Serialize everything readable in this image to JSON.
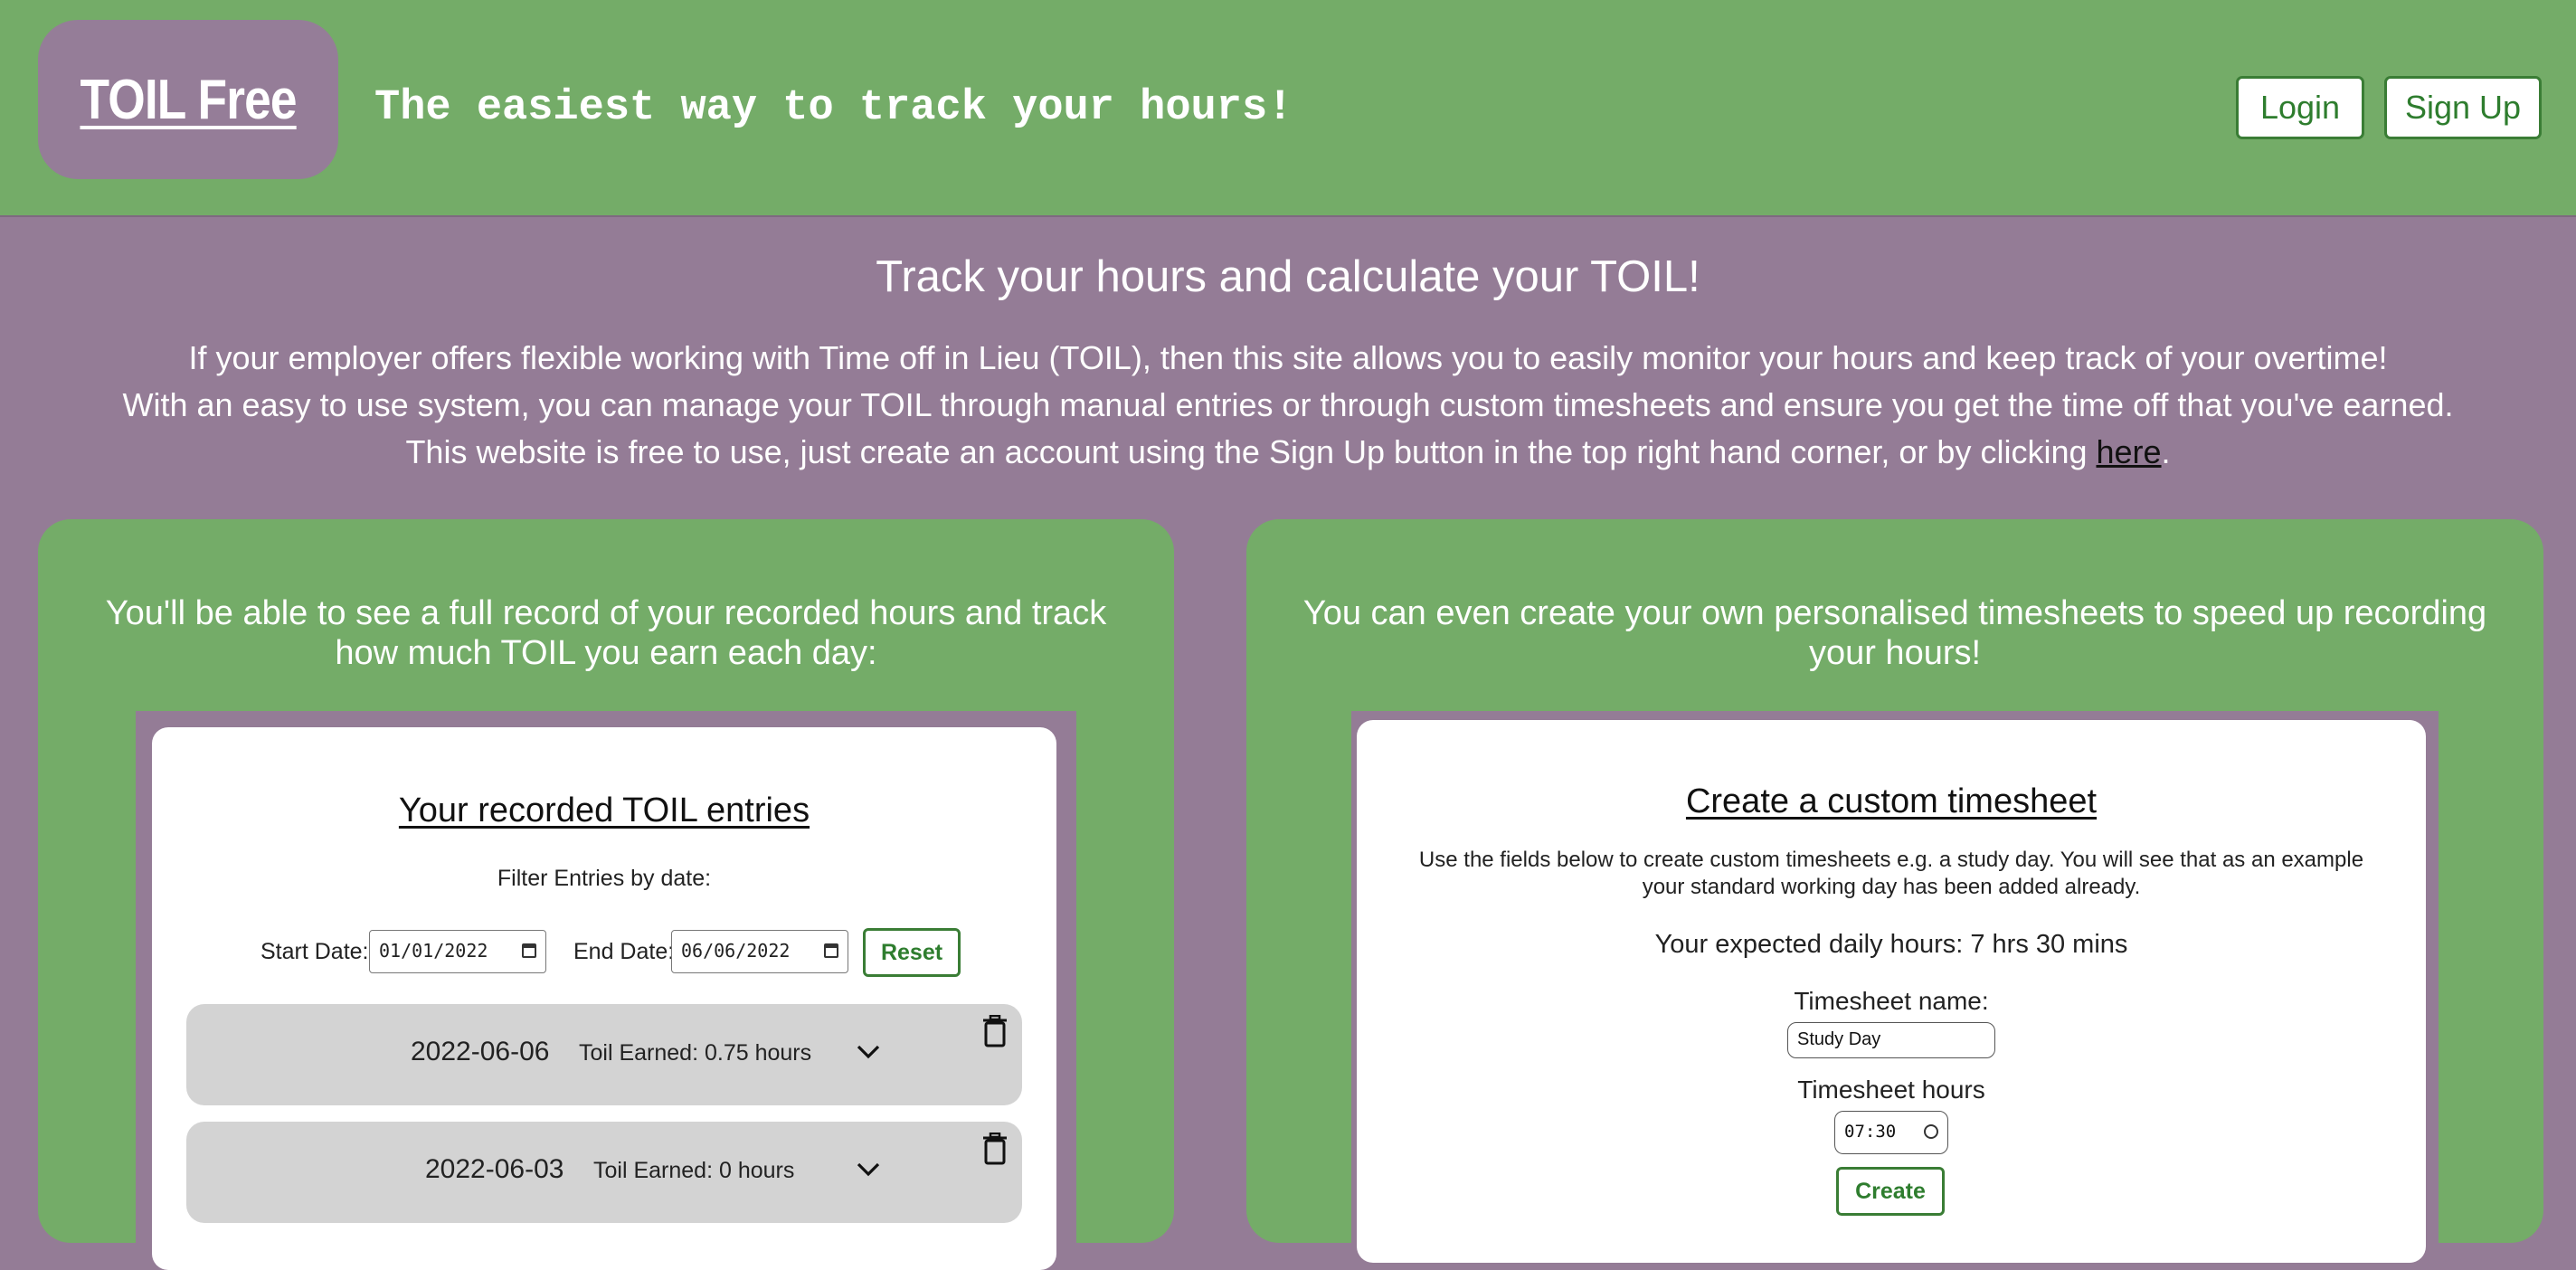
{
  "header": {
    "logo": "TOIL Free",
    "tagline": "The easiest way to track your hours!",
    "login_label": "Login",
    "signup_label": "Sign Up"
  },
  "intro": {
    "title": "Track your hours and calculate your TOIL!",
    "line1": "If your employer offers flexible working with Time off in Lieu (TOIL), then this site allows you to easily monitor your hours and keep track of your overtime!",
    "line2": "With an easy to use system, you can manage your TOIL through manual entries or through custom timesheets and ensure you get the time off that you've earned.",
    "line3_before": "This website is free to use, just create an account using the Sign Up button in the top right hand corner, or by clicking ",
    "line3_link": "here",
    "line3_after": "."
  },
  "left_panel": {
    "text": "You'll be able to see a full record of your recorded hours and track how much TOIL you earn each day:",
    "card": {
      "title": "Your recorded TOIL entries",
      "filter_label": "Filter Entries by date:",
      "start_label": "Start Date:",
      "start_value": "01/01/2022",
      "end_label": "End Date:",
      "end_value": "06/06/2022",
      "reset_label": "Reset",
      "entries": [
        {
          "date": "2022-06-06",
          "toil": "Toil Earned: 0.75 hours"
        },
        {
          "date": "2022-06-03",
          "toil": "Toil Earned: 0 hours"
        }
      ]
    }
  },
  "right_panel": {
    "text": "You can even create your own personalised timesheets to speed up recording your hours!",
    "card": {
      "title": "Create a custom timesheet",
      "description": "Use the fields below to create custom timesheets e.g. a study day. You will see that as an example your standard working day has been added already.",
      "expected_hours": "Your expected daily hours: 7 hrs 30 mins",
      "name_label": "Timesheet name:",
      "name_value": "Study Day",
      "hours_label": "Timesheet hours",
      "hours_value": "07:30",
      "create_label": "Create"
    }
  },
  "colors": {
    "green": "#74ac68",
    "purple": "#947c96",
    "button_green": "#2e7d2e",
    "entry_grey": "#d3d3d3"
  },
  "icons": [
    "calendar-icon",
    "chevron-down-icon",
    "trash-icon",
    "clock-icon"
  ]
}
